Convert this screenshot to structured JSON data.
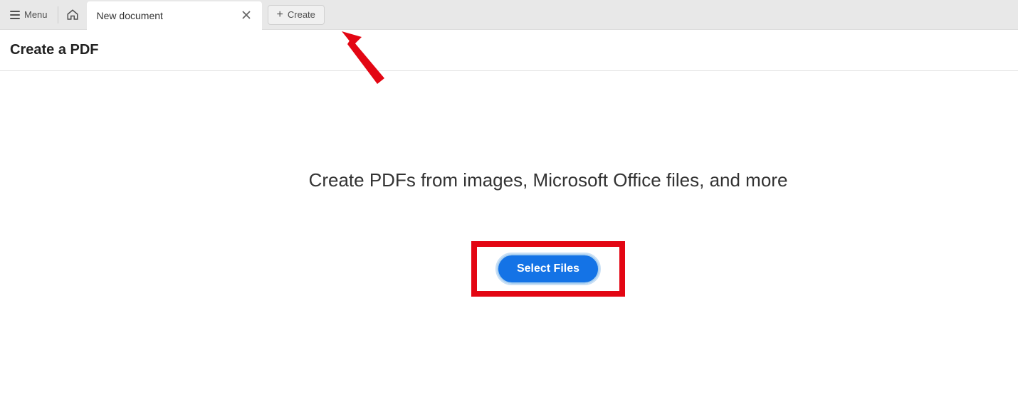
{
  "topbar": {
    "menu_label": "Menu",
    "tab_title": "New document",
    "create_label": "Create"
  },
  "header": {
    "title": "Create a PDF"
  },
  "content": {
    "hero": "Create PDFs from images, Microsoft Office files, and more",
    "select_files_label": "Select Files"
  }
}
